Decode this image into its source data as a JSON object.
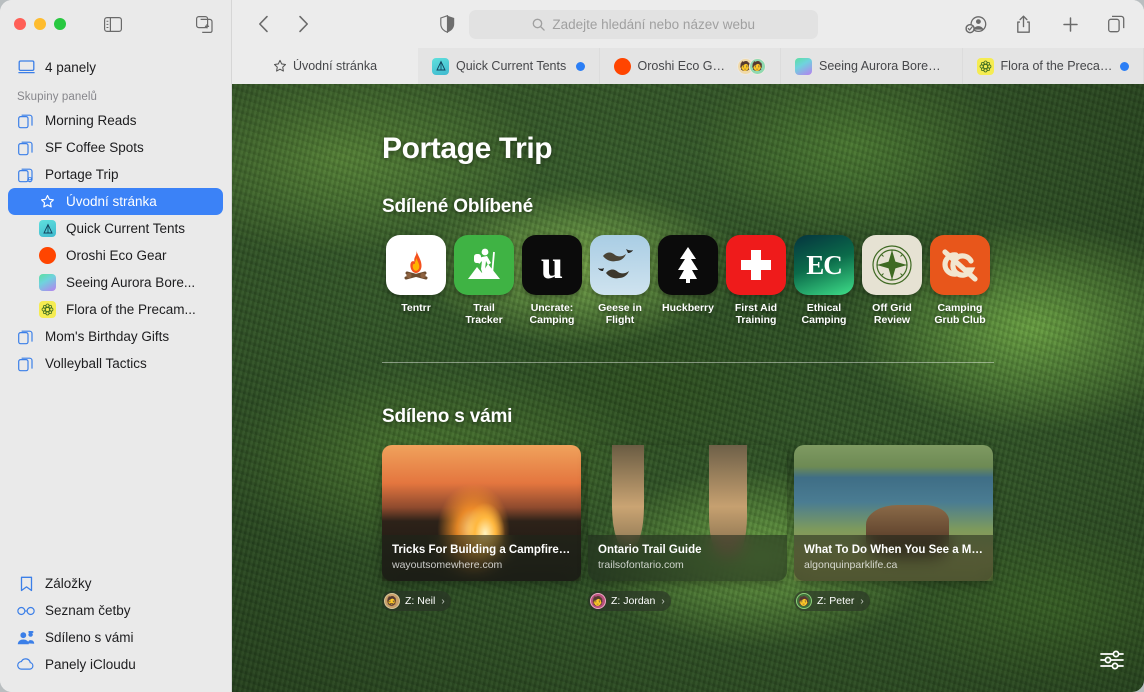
{
  "window": {
    "traffic_lights": [
      "close",
      "minimize",
      "maximize"
    ]
  },
  "sidebar": {
    "toggle_icon": "sidebar-toggle-icon",
    "newtab_icon": "new-tab-group-icon",
    "tabs_overview": {
      "label": "4 panely",
      "icon": "display-icon"
    },
    "section_label": "Skupiny panelů",
    "groups": [
      {
        "label": "Morning Reads",
        "icon": "tab-group-icon"
      },
      {
        "label": "SF Coffee Spots",
        "icon": "tab-group-icon"
      },
      {
        "label": "Portage Trip",
        "icon": "shared-tab-group-icon"
      }
    ],
    "portage_tabs": [
      {
        "label": "Úvodní stránka",
        "icon": "star-icon",
        "selected": true
      },
      {
        "label": "Quick Current Tents",
        "icon": "favicon-tents",
        "selected": false
      },
      {
        "label": "Oroshi Eco Gear",
        "icon": "favicon-oroshi",
        "selected": false
      },
      {
        "label": "Seeing Aurora Bore...",
        "icon": "favicon-aurora",
        "selected": false
      },
      {
        "label": "Flora of the Precam...",
        "icon": "favicon-flora",
        "selected": false
      }
    ],
    "groups_after": [
      {
        "label": "Mom's Birthday Gifts",
        "icon": "tab-group-icon"
      },
      {
        "label": "Volleyball Tactics",
        "icon": "tab-group-icon"
      }
    ],
    "bottom": [
      {
        "label": "Záložky",
        "icon": "bookmark-icon"
      },
      {
        "label": "Seznam četby",
        "icon": "reading-list-icon"
      },
      {
        "label": "Sdíleno s vámi",
        "icon": "shared-with-you-icon"
      },
      {
        "label": "Panely iCloudu",
        "icon": "icloud-tabs-icon"
      }
    ]
  },
  "toolbar": {
    "back_icon": "back-chevron-icon",
    "forward_icon": "forward-chevron-icon",
    "privacy_icon": "privacy-shield-icon",
    "search_placeholder": "Zadejte hledání nebo název webu",
    "search_icon": "search-icon",
    "profile_icon": "profile-icon",
    "share_icon": "share-icon",
    "new_tab_icon": "plus-icon",
    "tab_overview_icon": "tab-overview-icon"
  },
  "tabs": [
    {
      "title": "Úvodní stránka",
      "icon": "star-icon",
      "active": true,
      "badge": "none"
    },
    {
      "title": "Quick Current Tents",
      "icon": "favicon-tents",
      "active": false,
      "badge": "blue-dot"
    },
    {
      "title": "Oroshi Eco Gear",
      "icon": "favicon-oroshi",
      "active": false,
      "badge": "avatars"
    },
    {
      "title": "Seeing Aurora Boreali...",
      "icon": "favicon-aurora",
      "active": false,
      "badge": "none"
    },
    {
      "title": "Flora of the Precambi...",
      "icon": "favicon-flora",
      "active": false,
      "badge": "blue-dot"
    }
  ],
  "start_page": {
    "title": "Portage Trip",
    "favorites_heading": "Sdílené Oblíbené",
    "favorites": [
      {
        "name": "Tentrr",
        "icon": "campfire-icon",
        "bg": "#ffffff"
      },
      {
        "name": "Trail\nTracker",
        "icon": "hiker-icon",
        "bg": "#3fb344"
      },
      {
        "name": "Uncrate:\nCamping",
        "icon": "letter-u-icon",
        "bg": "#0b0b0b"
      },
      {
        "name": "Geese in\nFlight",
        "icon": "geese-icon",
        "bg": "#b8d4e8"
      },
      {
        "name": "Huckberry",
        "icon": "pine-tree-icon",
        "bg": "#0b0b0b"
      },
      {
        "name": "First Aid\nTraining",
        "icon": "red-cross-icon",
        "bg": "#ef1b1b"
      },
      {
        "name": "Ethical\nCamping",
        "icon": "ec-monogram-icon",
        "bg": "#0d3d2e"
      },
      {
        "name": "Off Grid\nReview",
        "icon": "compass-icon",
        "bg": "#e6e2d3"
      },
      {
        "name": "Camping\nGrub Club",
        "icon": "cg-monogram-icon",
        "bg": "#e8561b"
      }
    ],
    "shared_heading": "Sdíleno s vámi",
    "shared_cards": [
      {
        "title": "Tricks For Building a Campfire—F...",
        "domain": "wayoutsomewhere.com",
        "image": "campfire-photo",
        "attrib": "Z: Neil",
        "avatar": "neil-avatar",
        "chevron": "chevron-right-icon"
      },
      {
        "title": "Ontario Trail Guide",
        "domain": "trailsofontario.com",
        "image": "hikers-sunset-photo",
        "attrib": "Z: Jordan",
        "avatar": "jordan-avatar",
        "chevron": "chevron-right-icon"
      },
      {
        "title": "What To Do When You See a Moo...",
        "domain": "algonquinparklife.ca",
        "image": "moose-pond-photo",
        "attrib": "Z: Peter",
        "avatar": "peter-avatar",
        "chevron": "chevron-right-icon"
      }
    ],
    "settings_icon": "start-page-settings-icon"
  },
  "colors": {
    "accent": "#3b82f7",
    "sidebar_bg": "#eaeaea",
    "toolbar_bg": "#ececec",
    "tab_inactive_bg": "#e4e4e4"
  }
}
